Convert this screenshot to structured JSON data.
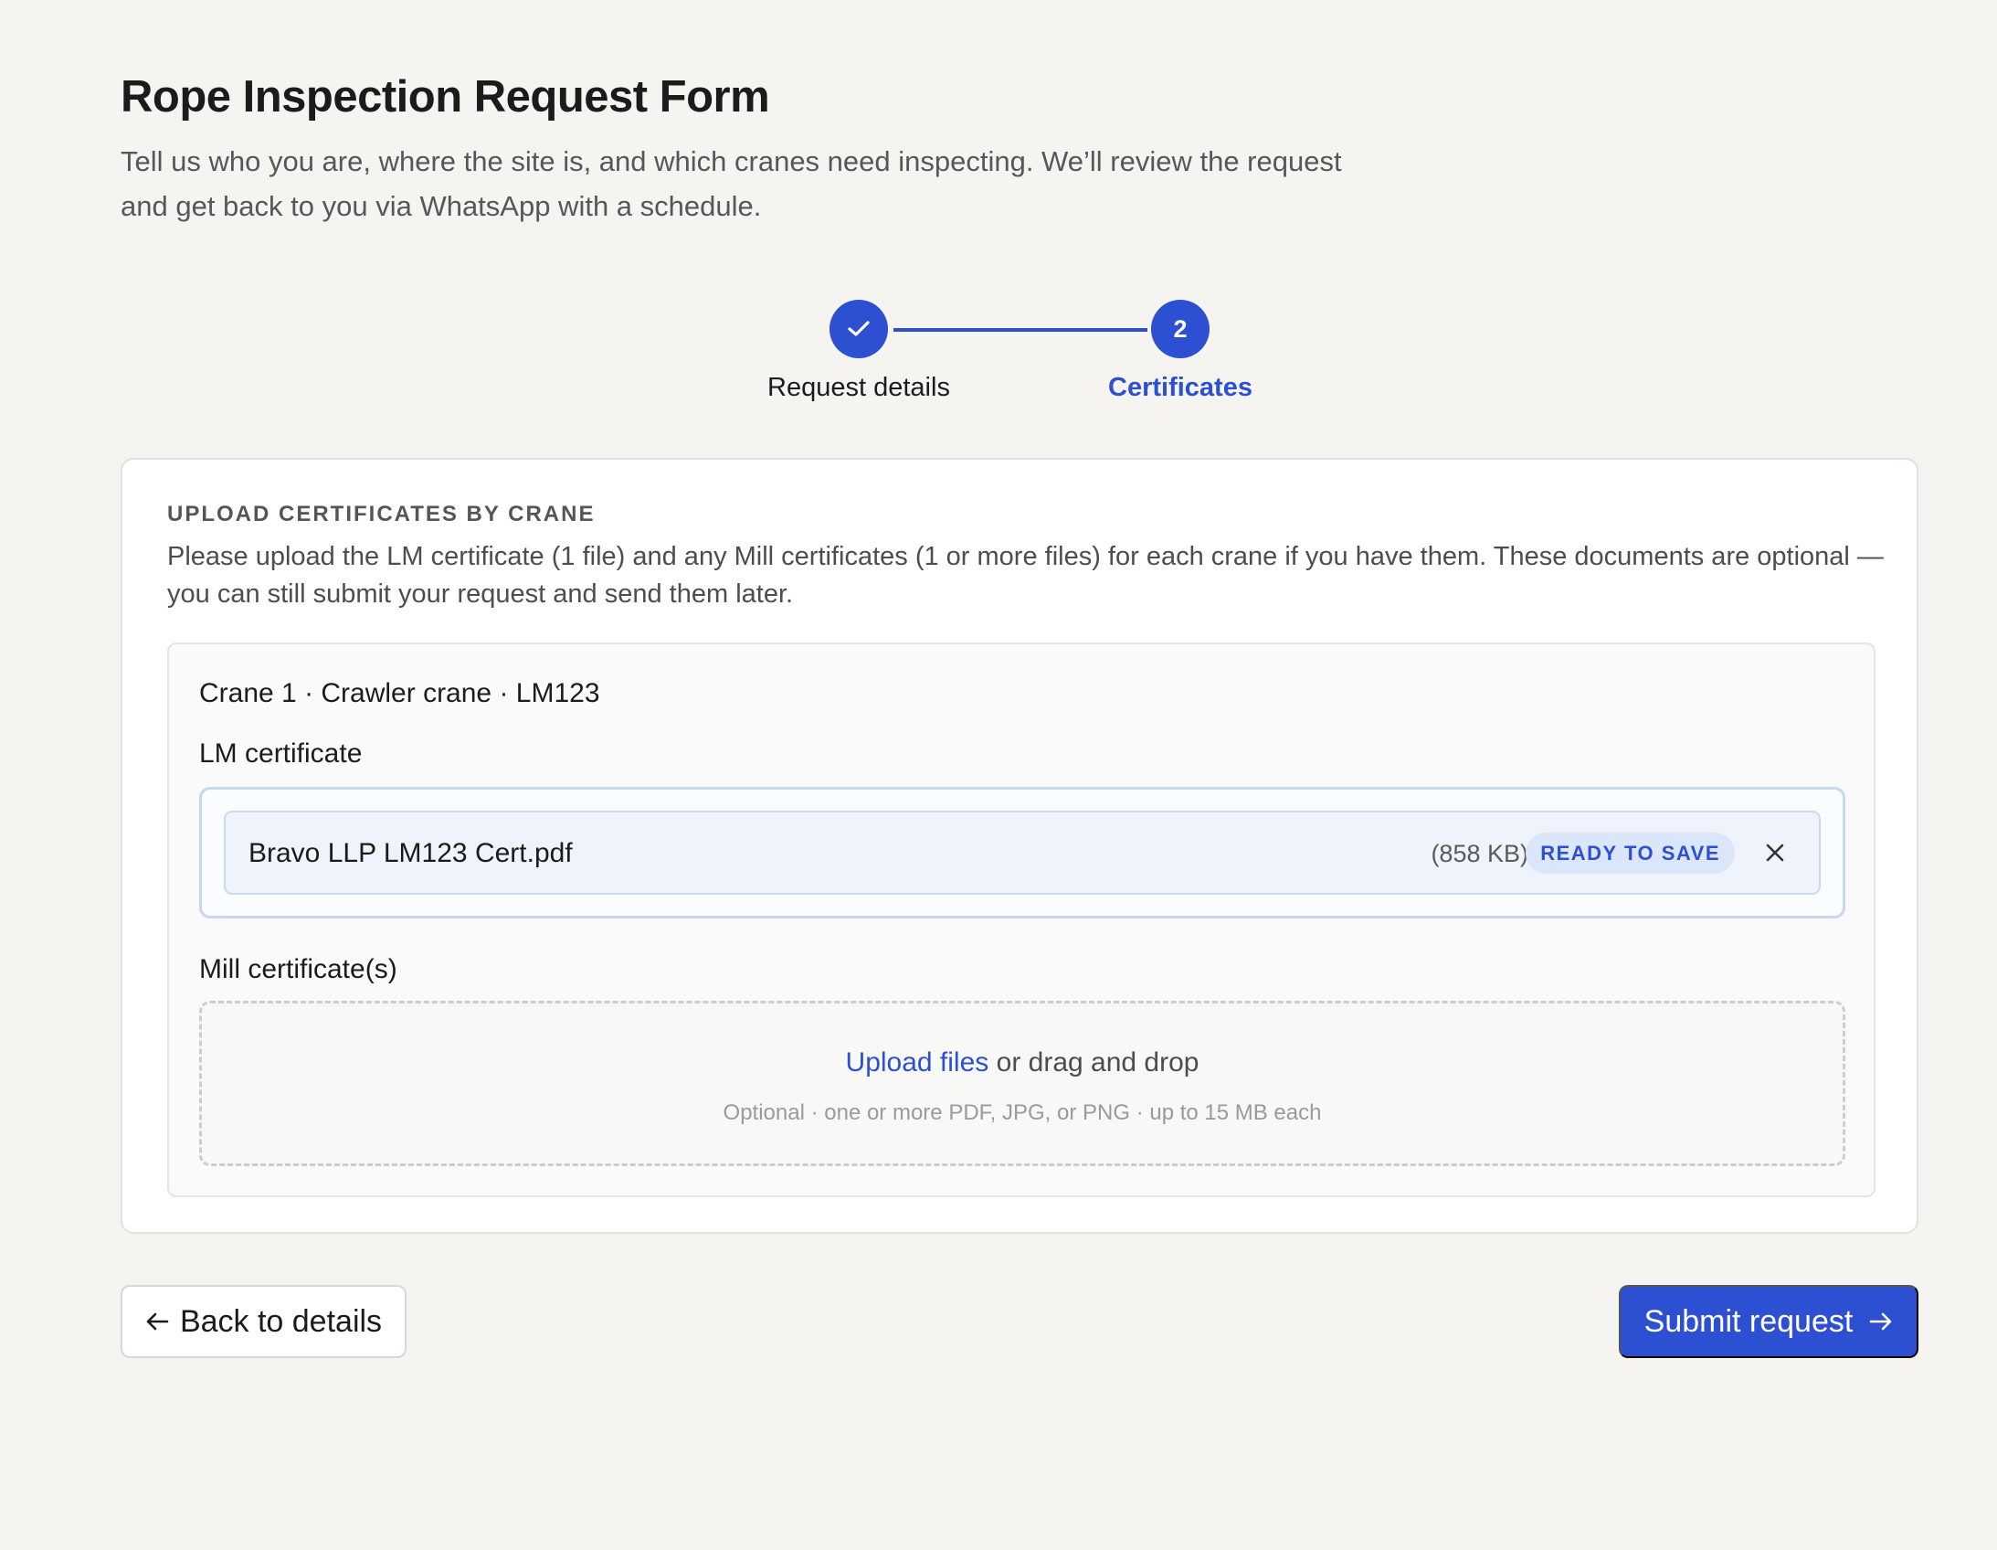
{
  "header": {
    "title": "Rope Inspection Request Form",
    "intro": "Tell us who you are, where the site is, and which cranes need inspecting. We’ll review the request and get back to you via WhatsApp with a schedule."
  },
  "stepper": {
    "steps": [
      {
        "label": "Request details",
        "status": "complete",
        "icon": "check-icon"
      },
      {
        "label": "Certificates",
        "status": "current",
        "number": "2"
      }
    ],
    "accent_color": "#2d4fd1"
  },
  "certificates": {
    "heading": "UPLOAD CERTIFICATES BY CRANE",
    "description": "Please upload the LM certificate (1 file) and any Mill certificates (1 or more files) for each crane if you have them. These documents are optional — you can still submit your request and send them later.",
    "cranes": [
      {
        "title": "Crane 1 · Crawler crane · LM123",
        "lm_label": "LM certificate",
        "lm_file": {
          "name": "Bravo LLP LM123 Cert.pdf",
          "size": "(858 KB)",
          "status": "READY TO SAVE"
        },
        "mill_label": "Mill certificate(s)",
        "mill_drop": {
          "link_text": "Upload files",
          "rest_text": " or drag and drop",
          "hint": "Optional · one or more PDF, JPG, or PNG · up to 15 MB each"
        }
      }
    ]
  },
  "footer": {
    "back_label": "Back to details",
    "submit_label": "Submit request"
  }
}
